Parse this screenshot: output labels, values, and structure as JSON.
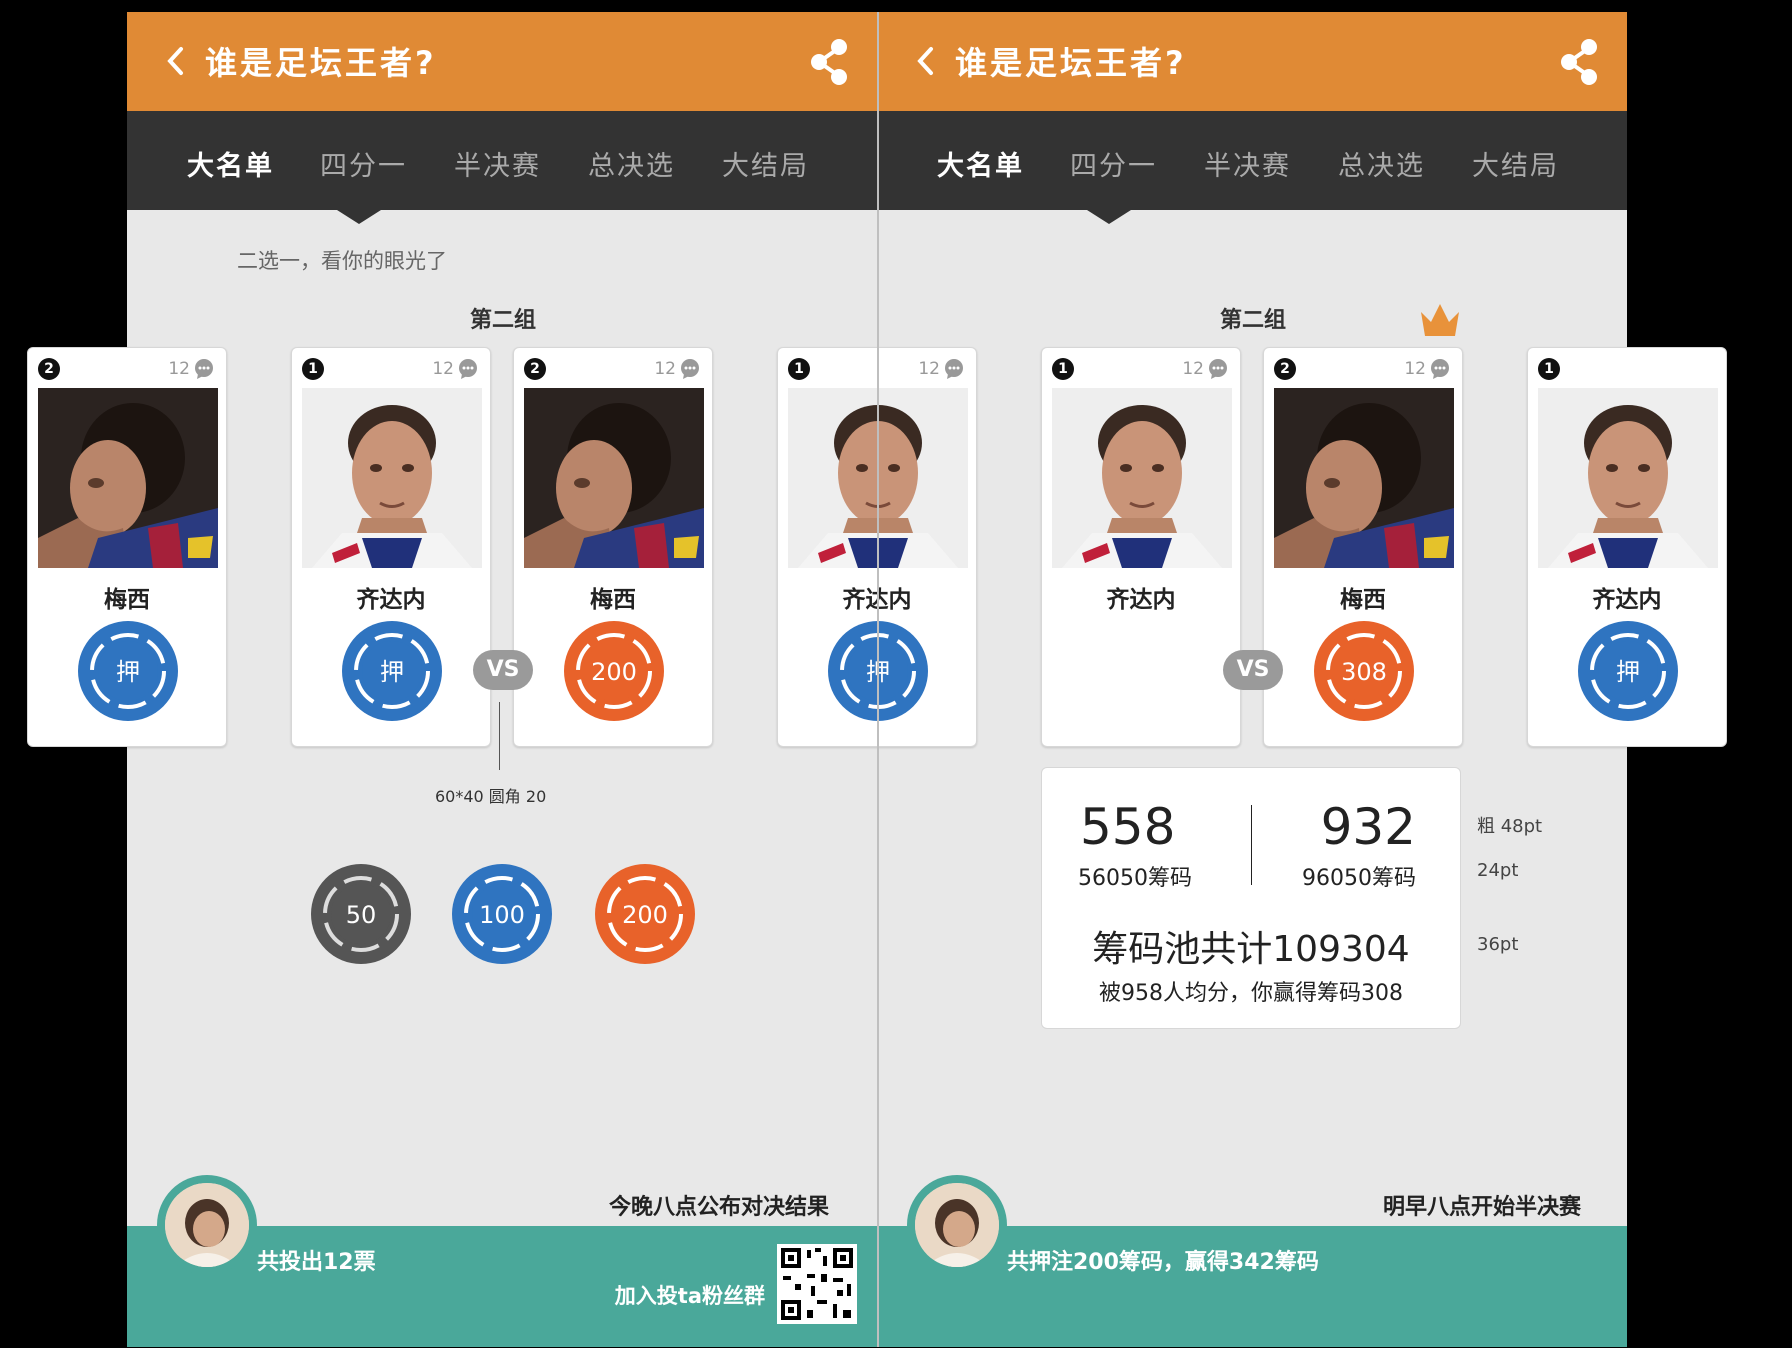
{
  "left": {
    "title": "谁是足坛王者?",
    "tabs": [
      "大名单",
      "四分一",
      "半决赛",
      "总决选",
      "大结局"
    ],
    "hint": "二选一，看你的眼光了",
    "group": "第二组",
    "cards": [
      {
        "seed": "2",
        "count": "12",
        "name": "梅西",
        "chip": "押",
        "photo": "messi"
      },
      {
        "seed": "1",
        "count": "12",
        "name": "齐达内",
        "chip": "押",
        "photo": "zidane"
      },
      {
        "seed": "2",
        "count": "12",
        "name": "梅西",
        "chip": "200",
        "photo": "messi"
      },
      {
        "seed": "1",
        "count": "12",
        "name": "齐达内",
        "chip": "押",
        "photo": "zidane"
      }
    ],
    "vs": "VS",
    "annotation": "60*40 圆角 20",
    "chip_options": [
      "50",
      "100",
      "200"
    ],
    "footer_msg": "今晚八点公布对决结果",
    "footer_stat": "共投出12票",
    "footer_join": "加入投ta粉丝群"
  },
  "right": {
    "title": "谁是足坛王者?",
    "tabs": [
      "大名单",
      "四分一",
      "半决赛",
      "总决选",
      "大结局"
    ],
    "group": "第二组",
    "cards": [
      {
        "seed": "1",
        "count": "12",
        "name": "齐达内",
        "chip": "押",
        "photo": "zidane"
      },
      {
        "seed": "1",
        "count": "12",
        "name": "齐达内",
        "chip": "",
        "photo": "zidane"
      },
      {
        "seed": "2",
        "count": "12",
        "name": "梅西",
        "chip": "308",
        "photo": "messi"
      },
      {
        "seed": "1",
        "count": "",
        "name": "齐达内",
        "chip": "押",
        "photo": "zidane"
      }
    ],
    "vs": "VS",
    "result": {
      "left_votes": "558",
      "left_chips": "56050筹码",
      "right_votes": "932",
      "right_chips": "96050筹码",
      "pool": "筹码池共计109304",
      "split": "被958人均分，你赢得筹码308"
    },
    "specs": [
      "粗 48pt",
      "24pt",
      "36pt"
    ],
    "footer_msg": "明早八点开始半决赛",
    "footer_stat": "共押注200筹码，赢得342筹码"
  },
  "colors": {
    "header": "#e08a35",
    "tabbar": "#333333",
    "footer": "#4aa89a",
    "chip_blue": "#2f74c0",
    "chip_orange": "#e8622a",
    "chip_gray": "#555555",
    "crown": "#e8923a"
  },
  "icons": [
    "back-icon",
    "share-icon",
    "comment-icon",
    "crown-icon",
    "qr-code"
  ]
}
